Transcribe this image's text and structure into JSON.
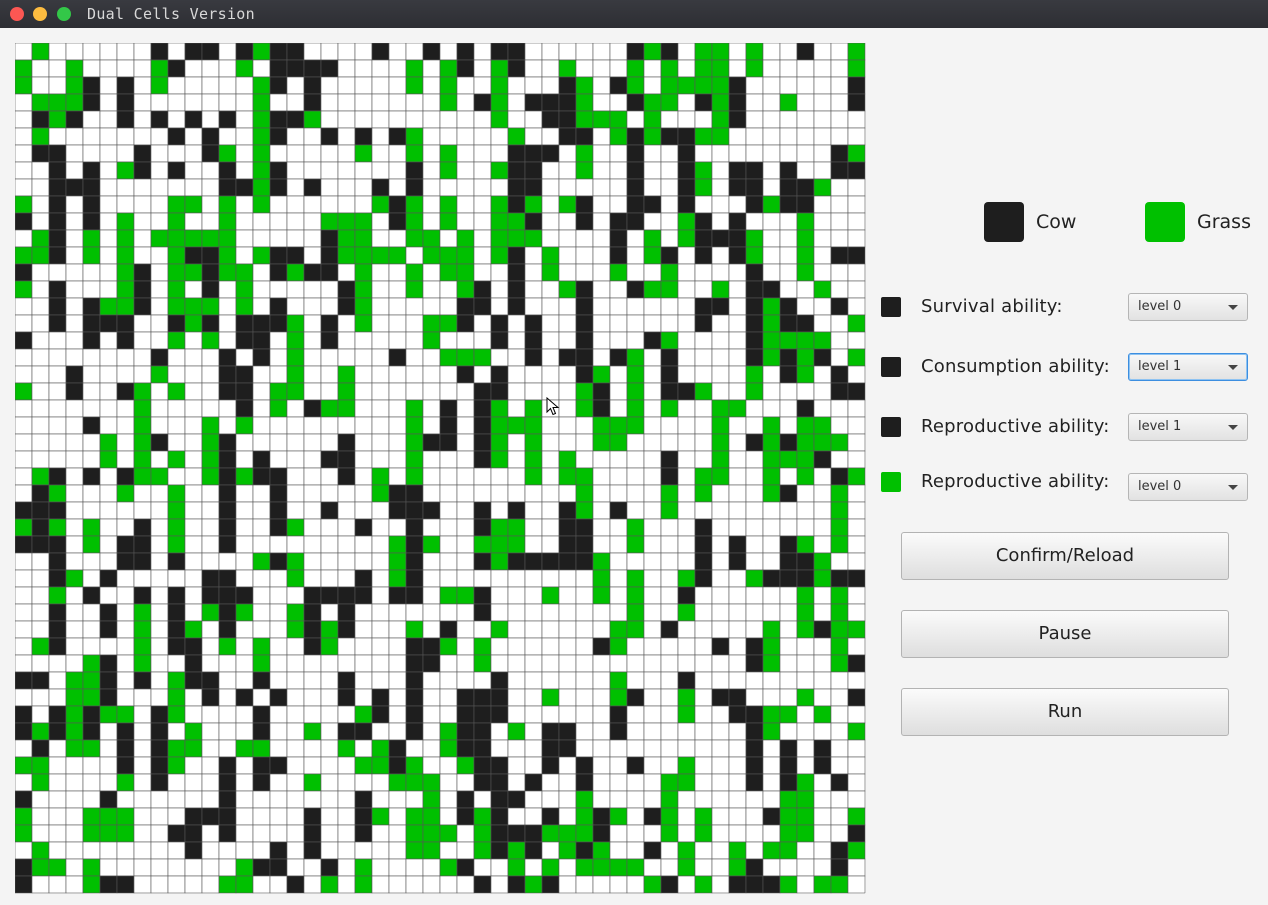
{
  "window": {
    "title": "Dual Cells Version"
  },
  "colors": {
    "cow": "#1e1e1e",
    "grass": "#00c000",
    "empty": "#ffffff",
    "grid_line": "#555555"
  },
  "grid": {
    "size": 50,
    "seed": 7
  },
  "legend": {
    "cow_label": "Cow",
    "grass_label": "Grass"
  },
  "settings": [
    {
      "swatch": "cow",
      "label": "Survival ability:",
      "value": "level 0"
    },
    {
      "swatch": "cow",
      "label": "Consumption ability:",
      "value": "level 1"
    },
    {
      "swatch": "cow",
      "label": "Reproductive ability:",
      "value": "level 1"
    },
    {
      "swatch": "grass",
      "label": "Reproductive ability:",
      "value": "level 0"
    }
  ],
  "buttons": {
    "confirm": "Confirm/Reload",
    "pause": "Pause",
    "run": "Run"
  }
}
